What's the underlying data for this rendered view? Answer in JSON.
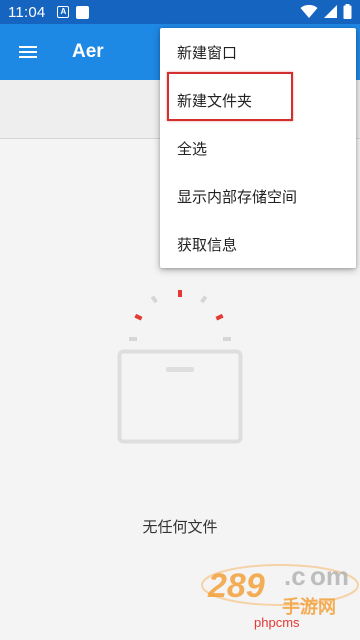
{
  "status_bar": {
    "time": "11:04",
    "notification_icon_label": "A",
    "icons": [
      "a-notification-icon",
      "square-notification-icon",
      "wifi-icon",
      "signal-icon",
      "battery-icon"
    ]
  },
  "app_bar": {
    "title": "Aer",
    "menu_icon": "hamburger-menu-icon"
  },
  "popup_menu": {
    "items": [
      {
        "label": "新建窗口"
      },
      {
        "label": "新建文件夹",
        "highlighted": true
      },
      {
        "label": "全选"
      },
      {
        "label": "显示内部存储空间"
      },
      {
        "label": "获取信息"
      }
    ]
  },
  "empty_state": {
    "icon": "empty-box-icon",
    "text": "无任何文件"
  },
  "watermark": {
    "brand": "289.com 手游网",
    "site": "phpcms"
  },
  "colors": {
    "status_bar": "#1565c0",
    "app_bar": "#1e88e5",
    "highlight": "#d32f2f",
    "accent_red": "#e53935"
  }
}
